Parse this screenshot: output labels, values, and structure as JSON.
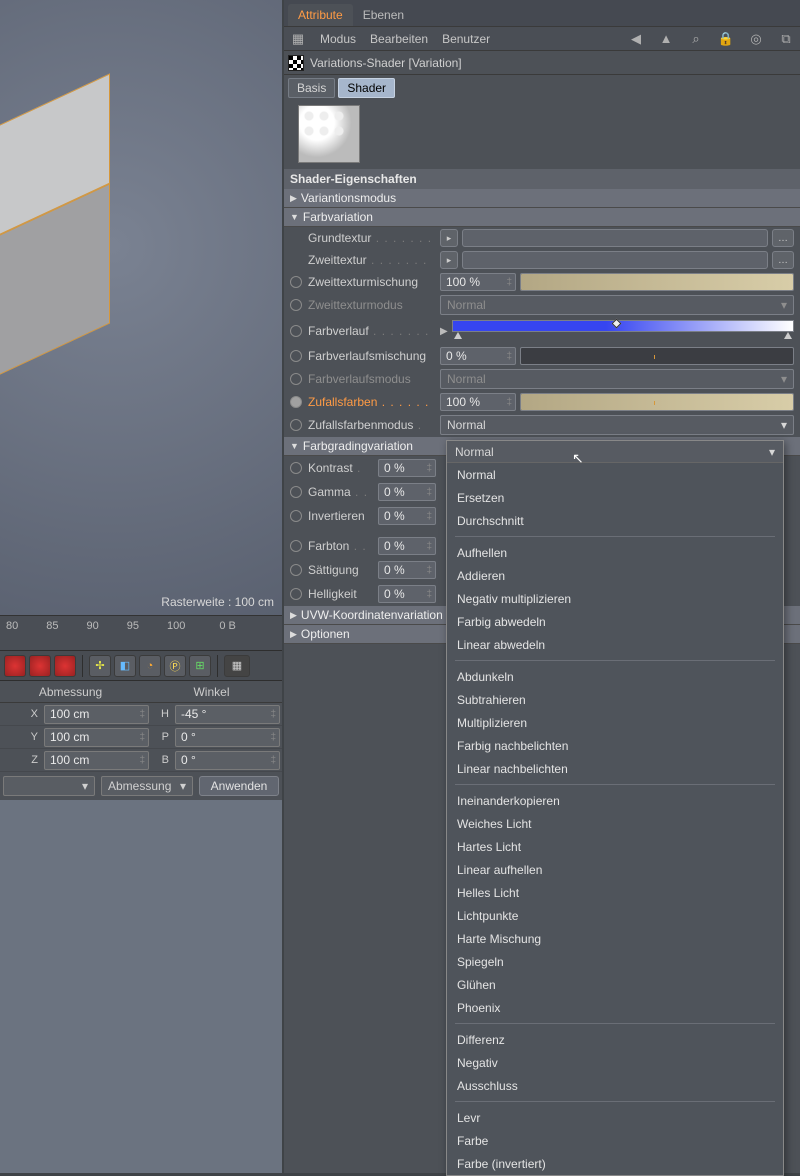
{
  "tabs": {
    "attribute": "Attribute",
    "layers": "Ebenen"
  },
  "menu": {
    "mode": "Modus",
    "edit": "Bearbeiten",
    "user": "Benutzer"
  },
  "object_name": "Variations-Shader [Variation]",
  "subtabs": {
    "basis": "Basis",
    "shader": "Shader"
  },
  "section_title": "Shader-Eigenschaften",
  "groups": {
    "variationsmodus": "Variantionsmodus",
    "farbvariation": "Farbvariation",
    "farbgrading": "Farbgradingvariation",
    "uvw": "UVW-Koordinatenvariation",
    "optionen": "Optionen"
  },
  "props": {
    "grundtextur": "Grundtextur",
    "zweittextur": "Zweittextur",
    "zweittexturmischung": "Zweittexturmischung",
    "zweittexturmodus": "Zweittexturmodus",
    "farbverlauf": "Farbverlauf",
    "farbverlaufsmischung": "Farbverlaufsmischung",
    "farbverlaufsmodus": "Farbverlaufsmodus",
    "zufallsfarben": "Zufallsfarben",
    "zufallsfarbenmodus": "Zufallsfarbenmodus",
    "kontrast": "Kontrast",
    "gamma": "Gamma",
    "invertieren": "Invertieren",
    "farbton": "Farbton",
    "saettigung": "Sättigung",
    "helligkeit": "Helligkeit"
  },
  "values": {
    "zweittexturmischung": "100 %",
    "zweittexturmodus": "Normal",
    "farbverlaufsmischung": "0 %",
    "farbverlaufsmodus": "Normal",
    "zufallsfarben": "100 %",
    "zufallsfarbenmodus_selected": "Normal",
    "kontrast": "0 %",
    "gamma": "0 %",
    "invertieren": "0 %",
    "farbton": "0 %",
    "saettigung": "0 %",
    "helligkeit": "0 %"
  },
  "dropdown_options": {
    "group1": [
      "Normal",
      "Ersetzen",
      "Durchschnitt"
    ],
    "group2": [
      "Aufhellen",
      "Addieren",
      "Negativ multiplizieren",
      "Farbig abwedeln",
      "Linear abwedeln"
    ],
    "group3": [
      "Abdunkeln",
      "Subtrahieren",
      "Multiplizieren",
      "Farbig nachbelichten",
      "Linear nachbelichten"
    ],
    "group4": [
      "Ineinanderkopieren",
      "Weiches Licht",
      "Hartes Licht",
      "Linear aufhellen",
      "Helles Licht",
      "Lichtpunkte",
      "Harte Mischung",
      "Spiegeln",
      "Glühen",
      "Phoenix"
    ],
    "group5": [
      "Differenz",
      "Negativ",
      "Ausschluss"
    ],
    "group6": [
      "Levr",
      "Farbe",
      "Farbe (invertiert)"
    ]
  },
  "viewport": {
    "grid_info": "Rasterweite : 100 cm"
  },
  "timeline": {
    "ticks": [
      "80",
      "85",
      "90",
      "95",
      "100"
    ],
    "bytes": "0 B"
  },
  "coord": {
    "head1": "Abmessung",
    "head2": "Winkel",
    "X": "X",
    "Y": "Y",
    "Z": "Z",
    "H": "H",
    "P": "P",
    "B": "B",
    "x": "100 cm",
    "y": "100 cm",
    "z": "100 cm",
    "h": "-45 °",
    "p": "0 °",
    "b": "0 °",
    "abmessung": "Abmessung",
    "anwenden": "Anwenden"
  }
}
